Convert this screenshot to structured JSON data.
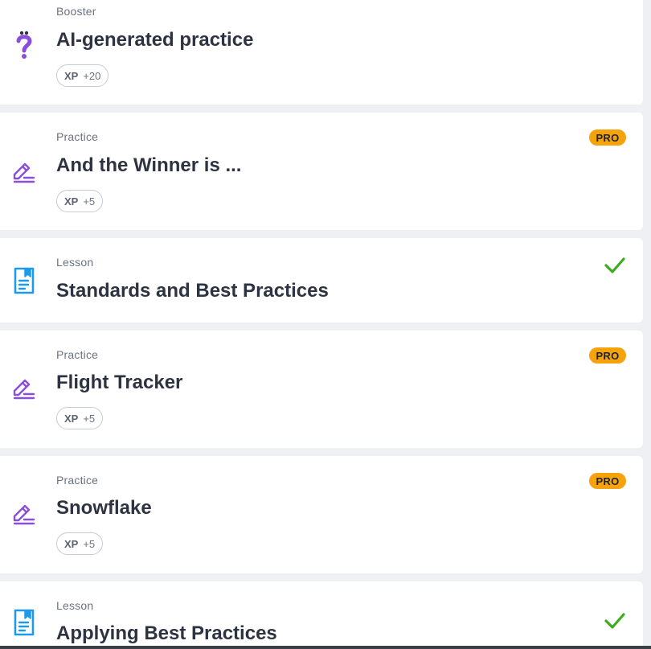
{
  "cards": [
    {
      "type": "Booster",
      "title": "AI-generated practice",
      "xp_label": "XP",
      "xp_value": "+20",
      "icon": "question-booster-icon",
      "pro": "",
      "completed": false
    },
    {
      "type": "Practice",
      "title": "And the Winner is ...",
      "xp_label": "XP",
      "xp_value": "+5",
      "icon": "pencil-practice-icon",
      "pro": "PRO",
      "completed": false
    },
    {
      "type": "Lesson",
      "title": "Standards and Best Practices",
      "xp_label": "",
      "xp_value": "",
      "icon": "lesson-doc-icon",
      "pro": "",
      "completed": true
    },
    {
      "type": "Practice",
      "title": "Flight Tracker",
      "xp_label": "XP",
      "xp_value": "+5",
      "icon": "pencil-practice-icon",
      "pro": "PRO",
      "completed": false
    },
    {
      "type": "Practice",
      "title": "Snowflake",
      "xp_label": "XP",
      "xp_value": "+5",
      "icon": "pencil-practice-icon",
      "pro": "PRO",
      "completed": false
    },
    {
      "type": "Lesson",
      "title": "Applying Best Practices",
      "xp_label": "",
      "xp_value": "",
      "icon": "lesson-doc-icon",
      "pro": "",
      "completed": true
    }
  ],
  "colors": {
    "pro_badge": "#f5a20b",
    "check": "#3cae1e",
    "practice_icon": "#8a4fd8",
    "lesson_icon": "#1e9be8",
    "title_text": "#2d3340"
  }
}
